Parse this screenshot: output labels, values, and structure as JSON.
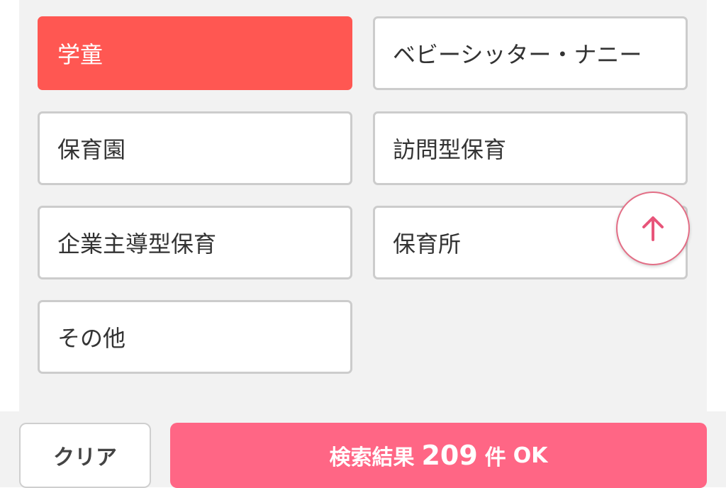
{
  "options": [
    {
      "label": "学童",
      "selected": true
    },
    {
      "label": "ベビーシッター・ナニー",
      "selected": false
    },
    {
      "label": "保育園",
      "selected": false
    },
    {
      "label": "訪問型保育",
      "selected": false
    },
    {
      "label": "企業主導型保育",
      "selected": false
    },
    {
      "label": "保育所",
      "selected": false
    },
    {
      "label": "その他",
      "selected": false
    }
  ],
  "scroll_top": {
    "icon": "arrow-up-icon"
  },
  "footer": {
    "clear_label": "クリア",
    "search_prefix": "検索結果",
    "search_count": "209",
    "search_unit": "件",
    "search_ok": "OK"
  },
  "colors": {
    "selected_option": "#ff5752",
    "search_button": "#ff6685",
    "panel_background": "#f2f2f2",
    "option_border": "#cccccc"
  }
}
